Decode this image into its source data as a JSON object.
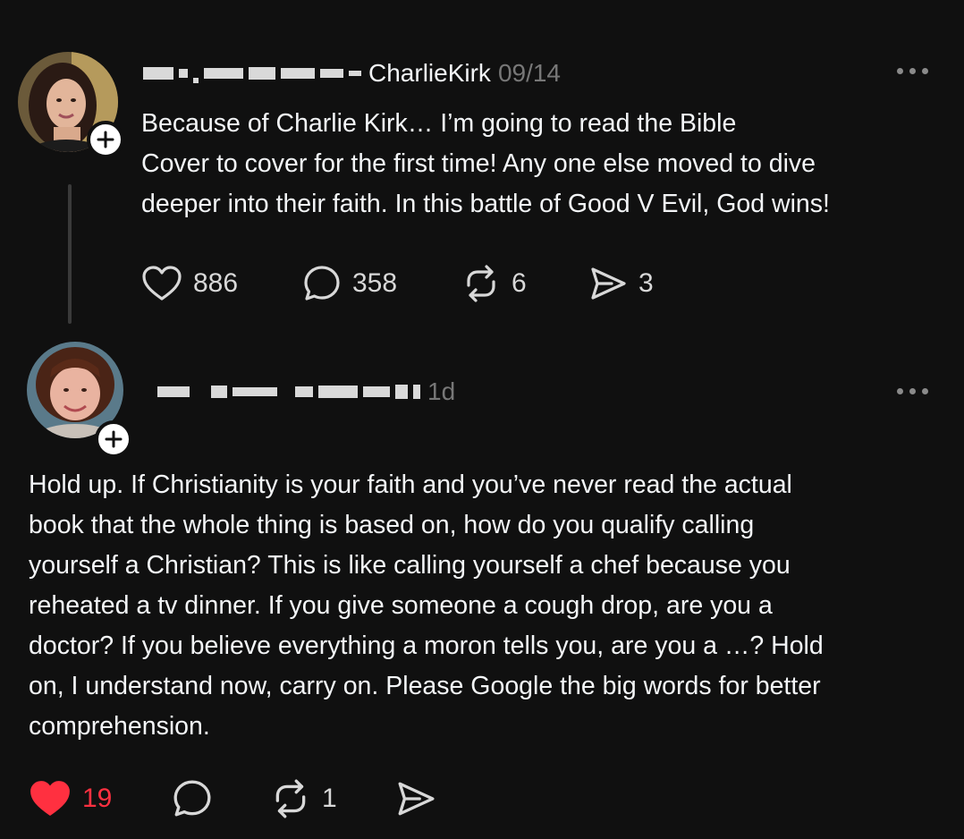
{
  "posts": [
    {
      "author_tag": "CharlieKirk",
      "time": "09/14",
      "text": "Because of Charlie Kirk… I’m going to read the Bible\nCover to cover for the first time! Any one else moved to dive\ndeeper into their faith. In this battle of Good V Evil, God wins!",
      "likes": "886",
      "replies": "358",
      "reposts": "6",
      "shares": "3",
      "liked": false
    },
    {
      "time": "1d",
      "text": "Hold up. If Christianity is your faith and you’ve never read the actual\nbook that the whole thing is based on, how do you qualify calling\nyourself a Christian? This is like calling yourself a chef because you\nreheated a tv dinner. If you give someone a cough drop, are you a\ndoctor? If you believe everything a moron tells you, are you a …? Hold\non, I understand now, carry on. Please Google the big words for better\ncomprehension.",
      "likes": "19",
      "reposts": "1",
      "liked": true
    }
  ],
  "colors": {
    "background": "#101010",
    "text": "#f3f5f7",
    "muted": "#777777",
    "like_active": "#ff3040"
  },
  "icons": [
    "heart-icon",
    "comment-icon",
    "repost-icon",
    "share-icon",
    "more-icon",
    "follow-plus-icon"
  ]
}
